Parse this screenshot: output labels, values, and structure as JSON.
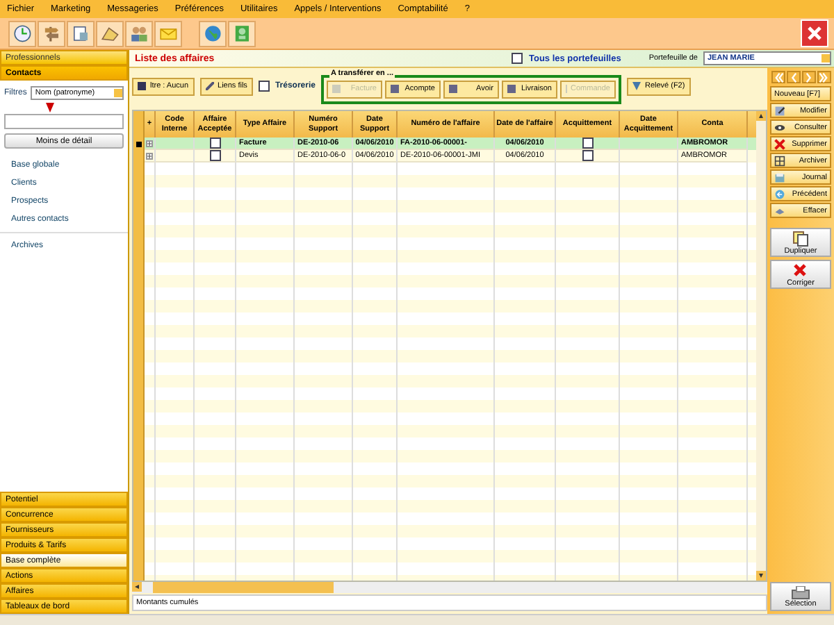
{
  "menu": [
    "Fichier",
    "Marketing",
    "Messageries",
    "Préférences",
    "Utilitaires",
    "Appels / Interventions",
    "Comptabilité",
    "?"
  ],
  "sidebar": {
    "header": "Professionnels",
    "active_section": "Contacts",
    "filter_label": "Filtres",
    "filter_value": "Nom (patronyme)",
    "detail_button": "Moins de détail",
    "items": [
      "Base globale",
      "Clients",
      "Prospects",
      "Autres contacts",
      "Archives"
    ],
    "sections": [
      {
        "label": "Potentiel",
        "selected": false
      },
      {
        "label": "Concurrence",
        "selected": false
      },
      {
        "label": "Fournisseurs",
        "selected": false
      },
      {
        "label": "Produits & Tarifs",
        "selected": false
      },
      {
        "label": "Base complète",
        "selected": true
      },
      {
        "label": "Actions",
        "selected": false
      },
      {
        "label": "Affaires",
        "selected": false
      },
      {
        "label": "Tableaux de bord",
        "selected": false
      }
    ]
  },
  "page_title": "Liste des affaires",
  "all_portfolios": {
    "label": "Tous les portefeuilles",
    "checked": false
  },
  "portfolio": {
    "label": "Portefeuille de",
    "value": "JEAN MARIE"
  },
  "actions": {
    "filter": "ltre : Aucun",
    "links": "Liens fils",
    "treasury": {
      "label": "Trésorerie",
      "checked": false
    },
    "transfer": {
      "title": "A transférer en ...",
      "buttons": [
        {
          "label": "Facture",
          "disabled": true
        },
        {
          "label": "Acompte",
          "disabled": false
        },
        {
          "label": "Avoir",
          "disabled": false
        },
        {
          "label": "Livraison",
          "disabled": false
        },
        {
          "label": "Commande",
          "disabled": true
        }
      ]
    },
    "statement": "Relevé (F2)"
  },
  "table": {
    "columns": [
      {
        "label": "+",
        "kind": "expand"
      },
      {
        "label": "Code Interne",
        "kind": "text"
      },
      {
        "label": "Affaire Acceptée",
        "kind": "check"
      },
      {
        "label": "Type Affaire",
        "kind": "text"
      },
      {
        "label": "Numéro Support",
        "kind": "text"
      },
      {
        "label": "Date Support",
        "kind": "text"
      },
      {
        "label": "Numéro de l'affaire",
        "kind": "text"
      },
      {
        "label": "Date de l'affaire",
        "kind": "text"
      },
      {
        "label": "Acquittement",
        "kind": "check"
      },
      {
        "label": "Date Acquittement",
        "kind": "text"
      },
      {
        "label": "Conta",
        "kind": "text"
      }
    ],
    "rows": [
      {
        "selected": true,
        "expanded": false,
        "cells": [
          "",
          "",
          false,
          "Facture",
          "DE-2010-06",
          "04/06/2010",
          "FA-2010-06-00001-",
          "04/06/2010",
          false,
          "",
          "AMBROMOR"
        ]
      },
      {
        "selected": false,
        "expanded": false,
        "cells": [
          "",
          "",
          false,
          "Devis",
          "DE-2010-06-0",
          "04/06/2010",
          "DE-2010-06-00001-JMI",
          "04/06/2010",
          false,
          "",
          "AMBROMOR"
        ]
      }
    ]
  },
  "totals_label": "Montants cumulés",
  "side_buttons": [
    "Nouveau [F7]",
    "Modifier",
    "Consulter",
    "Supprimer",
    "Archiver",
    "Journal",
    "Précédent",
    "Effacer"
  ],
  "big_buttons": [
    "Dupliquer",
    "Corriger"
  ],
  "selection_button": "Sélection"
}
